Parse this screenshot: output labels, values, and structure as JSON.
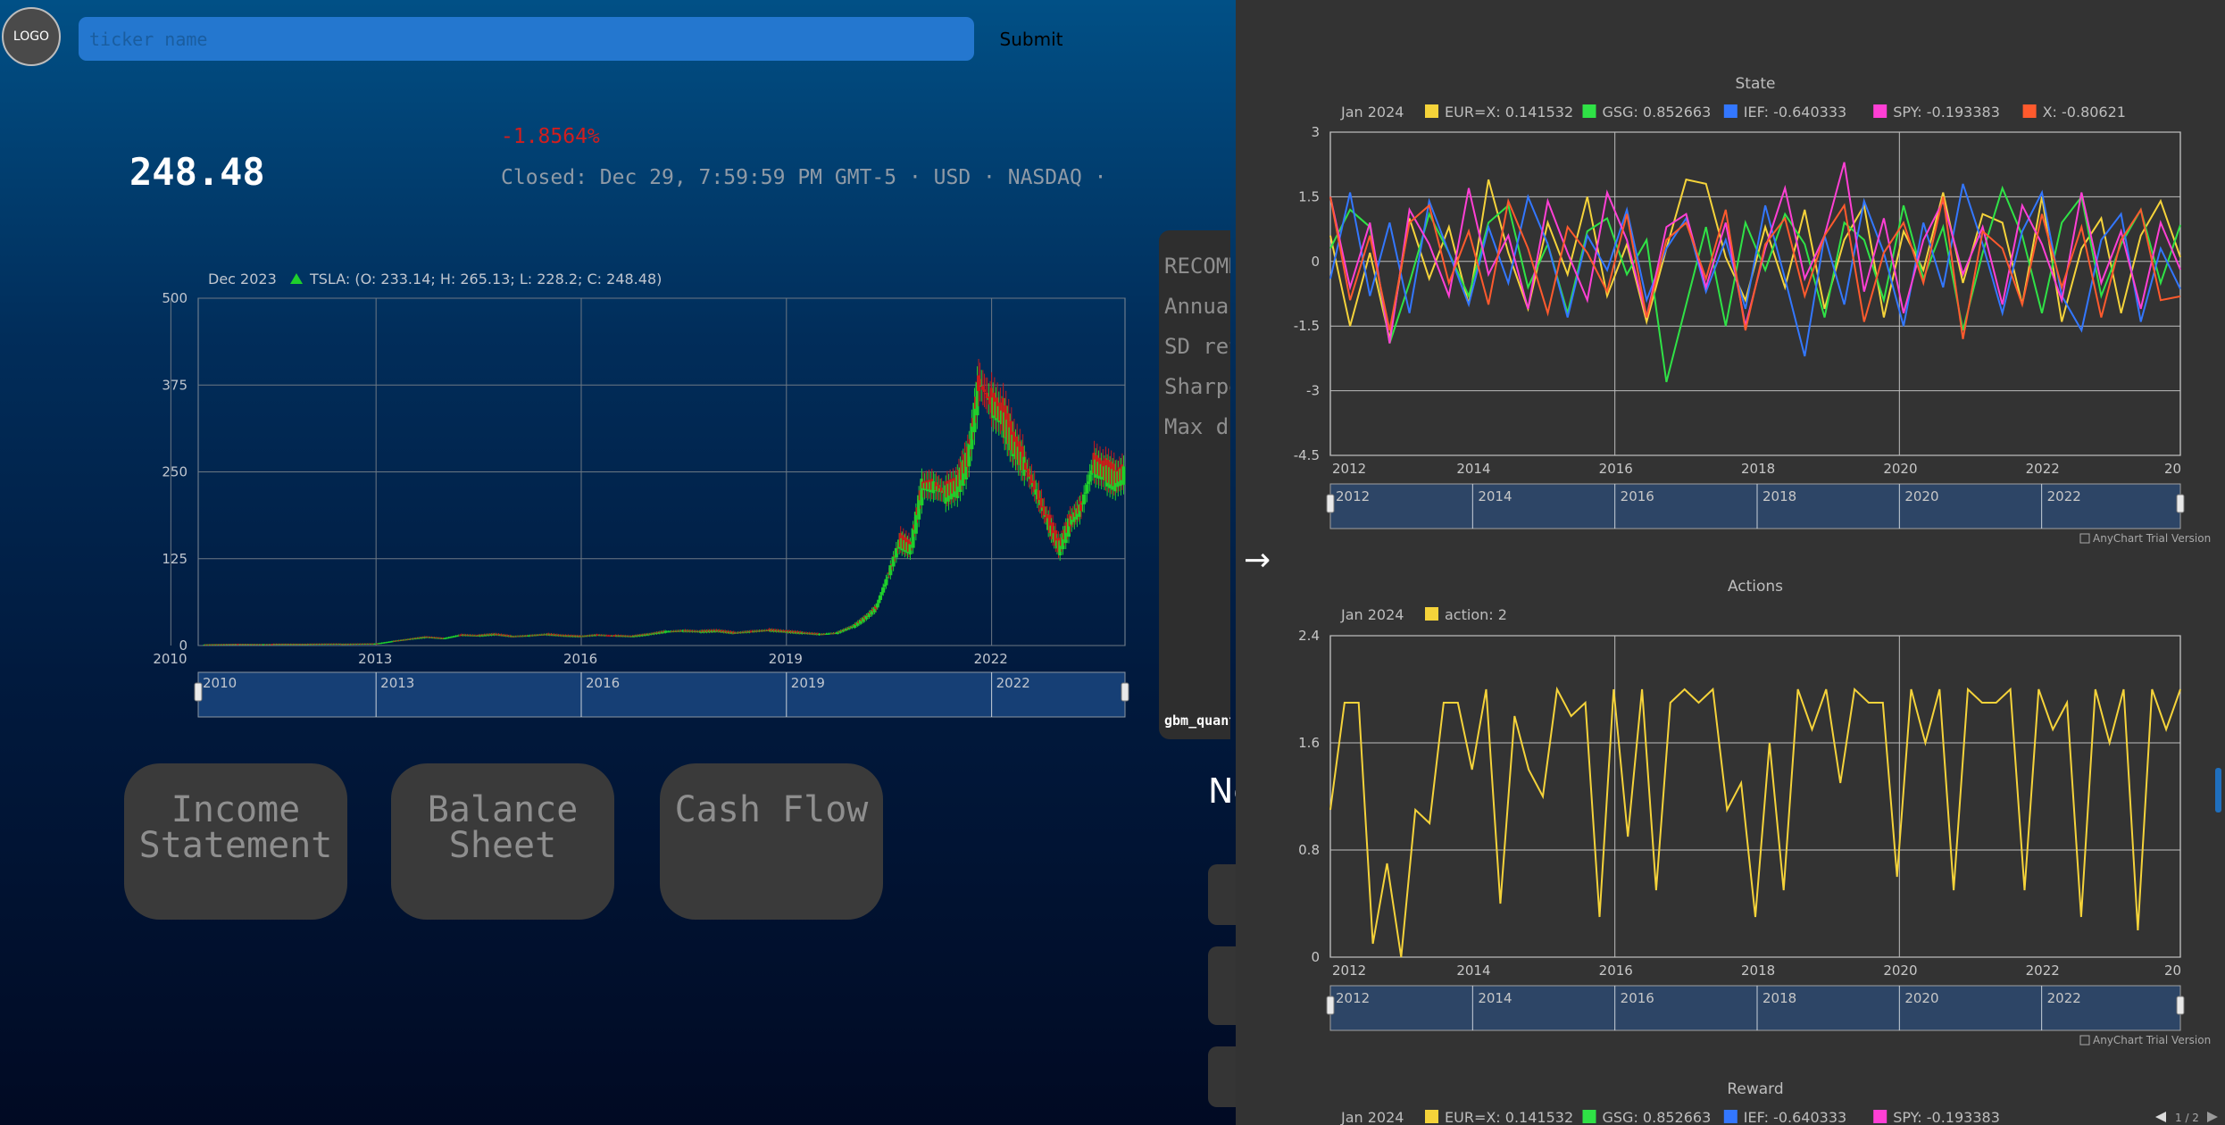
{
  "header": {
    "logo_text": "LOGO",
    "ticker_placeholder": "ticker name",
    "submit_label": "Submit"
  },
  "quote": {
    "price": "248.48",
    "change": "-1.8564%",
    "status": "Closed: Dec 29, 7:59:59 PM GMT-5 · USD · NASDAQ ·"
  },
  "price_chart": {
    "tooltip_date": "Dec 2023",
    "tooltip_text": "TSLA: (O: 233.14; H: 265.13; L: 228.2; C: 248.48)",
    "up_color": "#1fcf2c",
    "down_color": "#c81a1a"
  },
  "chart_data": [
    {
      "type": "candlestick",
      "symbol": "TSLA",
      "ylim": [
        0,
        500
      ],
      "y_ticks": [
        "0",
        "125",
        "250",
        "375",
        "500"
      ],
      "x_ticks": [
        "2010",
        "2013",
        "2016",
        "2019",
        "2022"
      ],
      "scroller_ticks": [
        "2010",
        "2013",
        "2016",
        "2019",
        "2022"
      ],
      "x_range": [
        2010.4,
        2023.95
      ],
      "series": [
        {
          "name": "TSLA",
          "x": [
            2010.5,
            2011.0,
            2011.5,
            2012.0,
            2012.5,
            2013.0,
            2013.25,
            2013.5,
            2013.75,
            2014.0,
            2014.25,
            2014.5,
            2014.75,
            2015.0,
            2015.25,
            2015.5,
            2015.75,
            2016.0,
            2016.25,
            2016.5,
            2016.75,
            2017.0,
            2017.25,
            2017.5,
            2017.75,
            2018.0,
            2018.25,
            2018.5,
            2018.75,
            2019.0,
            2019.25,
            2019.5,
            2019.75,
            2020.0,
            2020.17,
            2020.33,
            2020.5,
            2020.67,
            2020.83,
            2021.0,
            2021.17,
            2021.33,
            2021.5,
            2021.67,
            2021.83,
            2022.0,
            2022.17,
            2022.33,
            2022.5,
            2022.67,
            2022.83,
            2023.0,
            2023.17,
            2023.33,
            2023.5,
            2023.67,
            2023.83,
            2023.95
          ],
          "close": [
            1.5,
            1.8,
            1.9,
            2.0,
            2.2,
            2.4,
            6,
            9,
            12,
            10,
            15,
            14,
            16,
            13,
            14,
            16,
            14,
            13,
            15,
            14,
            13,
            16,
            20,
            21,
            20,
            21,
            18,
            20,
            22,
            20,
            18,
            16,
            18,
            28,
            40,
            55,
            100,
            150,
            140,
            230,
            230,
            220,
            230,
            270,
            380,
            350,
            330,
            290,
            260,
            220,
            180,
            140,
            180,
            200,
            260,
            250,
            240,
            248.48
          ]
        }
      ]
    },
    {
      "type": "line",
      "title": "State",
      "legend_date": "Jan 2024",
      "legend": [
        {
          "name": "EUR=X",
          "value": "0.141532",
          "color": "#f5d33a"
        },
        {
          "name": "GSG",
          "value": "0.852663",
          "color": "#2fe246"
        },
        {
          "name": "IEF",
          "value": "-0.640333",
          "color": "#3377ff"
        },
        {
          "name": "SPY",
          "value": "-0.193383",
          "color": "#ff3fd5"
        },
        {
          "name": "X",
          "value": "-0.80621",
          "color": "#ff5a2d"
        }
      ],
      "ylim": [
        -4.5,
        3
      ],
      "y_ticks": [
        "3",
        "1.5",
        "0",
        "-1.5",
        "-3",
        "-4.5"
      ],
      "x_ticks": [
        "2012",
        "2014",
        "2016",
        "2018",
        "2020",
        "2022",
        "20"
      ],
      "scroller_ticks": [
        "2012",
        "2014",
        "2016",
        "2018",
        "2020",
        "2022"
      ],
      "x_range": [
        2012.0,
        2023.95
      ],
      "series": [
        {
          "name": "EUR=X",
          "values": [
            0.6,
            -1.5,
            0.2,
            -1.8,
            1.0,
            -0.4,
            0.8,
            -1.0,
            1.9,
            0.2,
            -1.1,
            0.9,
            -0.3,
            1.5,
            -0.8,
            0.4,
            -1.4,
            0.3,
            1.9,
            1.8,
            0.1,
            -0.9,
            0.8,
            -0.6,
            1.2,
            -1.1,
            0.5,
            1.3,
            -1.3,
            0.7,
            -0.2,
            1.6,
            -0.5,
            1.1,
            0.9,
            -1.0,
            1.5,
            -1.4,
            0.3,
            1.0,
            -1.2,
            0.6,
            1.4,
            0.1
          ]
        },
        {
          "name": "GSG",
          "values": [
            0.3,
            1.2,
            0.8,
            -1.9,
            -0.5,
            1.1,
            0.2,
            -0.8,
            0.9,
            1.3,
            -0.6,
            0.4,
            -1.2,
            0.7,
            1.0,
            -0.3,
            0.5,
            -2.8,
            -1.0,
            0.8,
            -1.5,
            0.9,
            -0.2,
            1.1,
            0.4,
            -1.3,
            0.9,
            0.5,
            -0.9,
            1.3,
            -0.4,
            0.8,
            -1.6,
            0.2,
            1.7,
            0.6,
            -1.2,
            0.9,
            1.5,
            -0.8,
            0.4,
            1.2,
            -0.5,
            0.85
          ]
        },
        {
          "name": "IEF",
          "values": [
            -0.4,
            1.6,
            -0.8,
            0.9,
            -1.2,
            1.4,
            0.2,
            -1.0,
            0.8,
            -0.5,
            1.5,
            0.4,
            -1.3,
            0.6,
            -0.2,
            1.2,
            -0.9,
            0.3,
            1.0,
            -0.7,
            0.5,
            -1.1,
            1.3,
            -0.4,
            -2.2,
            0.6,
            -1.0,
            1.4,
            0.2,
            -1.5,
            0.9,
            -0.6,
            1.8,
            0.4,
            -1.2,
            0.7,
            1.6,
            -0.8,
            -1.6,
            0.5,
            1.1,
            -1.4,
            0.3,
            -0.64
          ]
        },
        {
          "name": "SPY",
          "values": [
            1.5,
            -0.6,
            0.9,
            -1.9,
            1.2,
            0.4,
            -0.8,
            1.7,
            -0.3,
            0.6,
            -1.1,
            1.4,
            0.2,
            -0.9,
            1.6,
            0.5,
            -1.3,
            0.8,
            1.1,
            -0.6,
            0.9,
            -1.5,
            0.3,
            1.7,
            -0.4,
            0.6,
            2.3,
            -0.7,
            1.0,
            -1.2,
            0.5,
            1.4,
            -0.3,
            0.8,
            -1.0,
            1.3,
            0.4,
            -0.9,
            1.6,
            -0.5,
            0.7,
            -1.1,
            0.9,
            -0.19
          ]
        },
        {
          "name": "X",
          "values": [
            1.5,
            -0.9,
            0.6,
            -1.6,
            0.9,
            1.3,
            -0.5,
            0.7,
            -1.0,
            1.4,
            0.3,
            -1.2,
            0.8,
            0.2,
            -0.7,
            1.1,
            -1.3,
            0.5,
            0.9,
            -0.4,
            1.2,
            -1.6,
            0.4,
            1.0,
            -0.8,
            0.6,
            1.3,
            -1.4,
            0.2,
            0.9,
            -0.5,
            1.5,
            -1.8,
            0.7,
            0.3,
            -1.0,
            1.1,
            -0.6,
            0.8,
            -1.3,
            0.5,
            1.2,
            -0.9,
            -0.81
          ]
        }
      ]
    },
    {
      "type": "line",
      "title": "Actions",
      "legend_date": "Jan 2024",
      "legend": [
        {
          "name": "action",
          "value": "2",
          "color": "#f5d33a"
        }
      ],
      "ylim": [
        0,
        2.4
      ],
      "y_ticks": [
        "2.4",
        "1.6",
        "0.8",
        "0"
      ],
      "x_ticks": [
        "2012",
        "2014",
        "2016",
        "2018",
        "2020",
        "2022",
        "20"
      ],
      "scroller_ticks": [
        "2012",
        "2014",
        "2016",
        "2018",
        "2020",
        "2022"
      ],
      "x_range": [
        2012.0,
        2023.95
      ],
      "series": [
        {
          "name": "action",
          "values": [
            1.1,
            1.9,
            1.9,
            0.1,
            0.7,
            0.0,
            1.1,
            1.0,
            1.9,
            1.9,
            1.4,
            2.0,
            0.4,
            1.8,
            1.4,
            1.2,
            2.0,
            1.8,
            1.9,
            0.3,
            2.0,
            0.9,
            2.0,
            0.5,
            1.9,
            2.0,
            1.9,
            2.0,
            1.1,
            1.3,
            0.3,
            1.6,
            0.5,
            2.0,
            1.7,
            2.0,
            1.3,
            2.0,
            1.9,
            1.9,
            0.6,
            2.0,
            1.6,
            2.0,
            0.5,
            2.0,
            1.9,
            1.9,
            2.0,
            0.5,
            2.0,
            1.7,
            1.9,
            0.3,
            2.0,
            1.6,
            2.0,
            0.2,
            2.0,
            1.7,
            2.0
          ]
        }
      ]
    },
    {
      "type": "line",
      "title": "Reward",
      "legend_date": "Jan 2024",
      "legend": [
        {
          "name": "EUR=X",
          "value": "0.141532",
          "color": "#f5d33a"
        },
        {
          "name": "GSG",
          "value": "0.852663",
          "color": "#2fe246"
        },
        {
          "name": "IEF",
          "value": "-0.640333",
          "color": "#3377ff"
        },
        {
          "name": "SPY",
          "value": "-0.193383",
          "color": "#ff3fd5"
        }
      ]
    }
  ],
  "financials": {
    "income_label": "Income Statement",
    "balance_label": "Balance Sheet",
    "cash_label": "Cash Flow"
  },
  "recommendation": {
    "lines": [
      "RECOMM",
      "Annual",
      "SD ret",
      "Sharpe",
      "Max dr"
    ],
    "model": "gbm_quant"
  },
  "news": {
    "heading": "Ne"
  },
  "panel": {
    "arrow": "→",
    "credit": "AnyChart Trial Version",
    "pager": "1 / 2"
  }
}
